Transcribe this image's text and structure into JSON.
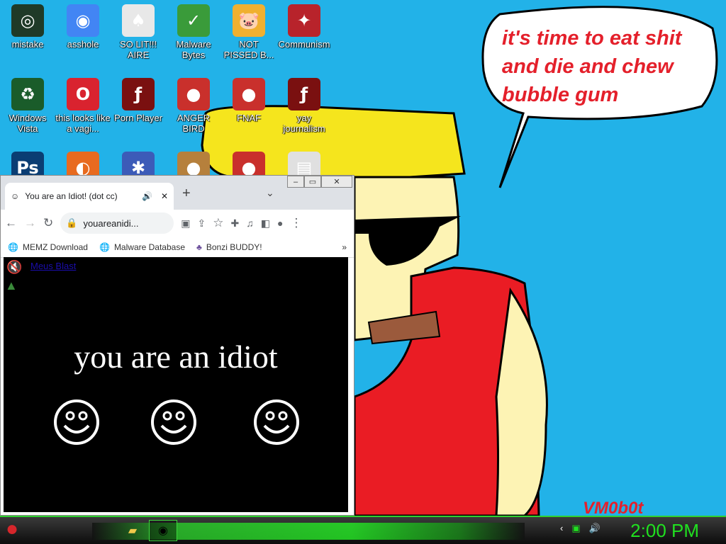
{
  "desktop": {
    "icons": [
      {
        "label": "mistake",
        "glyph": "◎",
        "bg": "#1f3a28"
      },
      {
        "label": "asshole",
        "glyph": "◉",
        "bg": "#4285f4"
      },
      {
        "label": "SO LIT!!! AIRE",
        "glyph": "♠",
        "bg": "#e8e8e8"
      },
      {
        "label": "Malware Bytes",
        "glyph": "✓",
        "bg": "#3a9b3a"
      },
      {
        "label": "NOT PISSED B...",
        "glyph": "🐷",
        "bg": "#f0b030"
      },
      {
        "label": "Communism",
        "glyph": "✦",
        "bg": "#b8232b"
      },
      {
        "label": "Windows Vista",
        "glyph": "♻",
        "bg": "#1a5c2a"
      },
      {
        "label": "this looks like a vagi...",
        "glyph": "O",
        "bg": "#d9232f"
      },
      {
        "label": "Porn Player",
        "glyph": "ƒ",
        "bg": "#7a1010"
      },
      {
        "label": "ANGER BIRD",
        "glyph": "●",
        "bg": "#c9302c"
      },
      {
        "label": "FNAF",
        "glyph": "●",
        "bg": "#c9302c"
      },
      {
        "label": "yay journalism",
        "glyph": "ƒ",
        "bg": "#7a1010"
      },
      {
        "label": "",
        "glyph": "Ps",
        "bg": "#0a3d73"
      },
      {
        "label": "",
        "glyph": "◐",
        "bg": "#e86a1f"
      },
      {
        "label": "",
        "glyph": "✱",
        "bg": "#3c5bb8"
      },
      {
        "label": "",
        "glyph": "●",
        "bg": "#b6803c"
      },
      {
        "label": "",
        "glyph": "●",
        "bg": "#c9302c"
      },
      {
        "label": "",
        "glyph": "▤",
        "bg": "#e0e0e0"
      }
    ]
  },
  "wallpaper": {
    "speech_bubble": "it's time to eat shit and die and chew bubble gum",
    "signature": "VM0b0t"
  },
  "browser": {
    "tab_title": "You are an Idiot! (dot cc)",
    "address": "youareanidi...",
    "bookmarks": [
      {
        "label": "MEMZ Download",
        "icon": "globe-icon"
      },
      {
        "label": "Malware Database",
        "icon": "globe-icon"
      },
      {
        "label": "Bonzi BUDDY!",
        "icon": "bonzi-icon"
      }
    ],
    "page": {
      "link_text": "Meus Blast",
      "heading": "you are an idiot"
    }
  },
  "taskbar": {
    "clock": "2:00 PM"
  },
  "colors": {
    "desktop_bg": "#22b2e8",
    "speech_red": "#e4202b",
    "clock_green": "#20e020"
  }
}
